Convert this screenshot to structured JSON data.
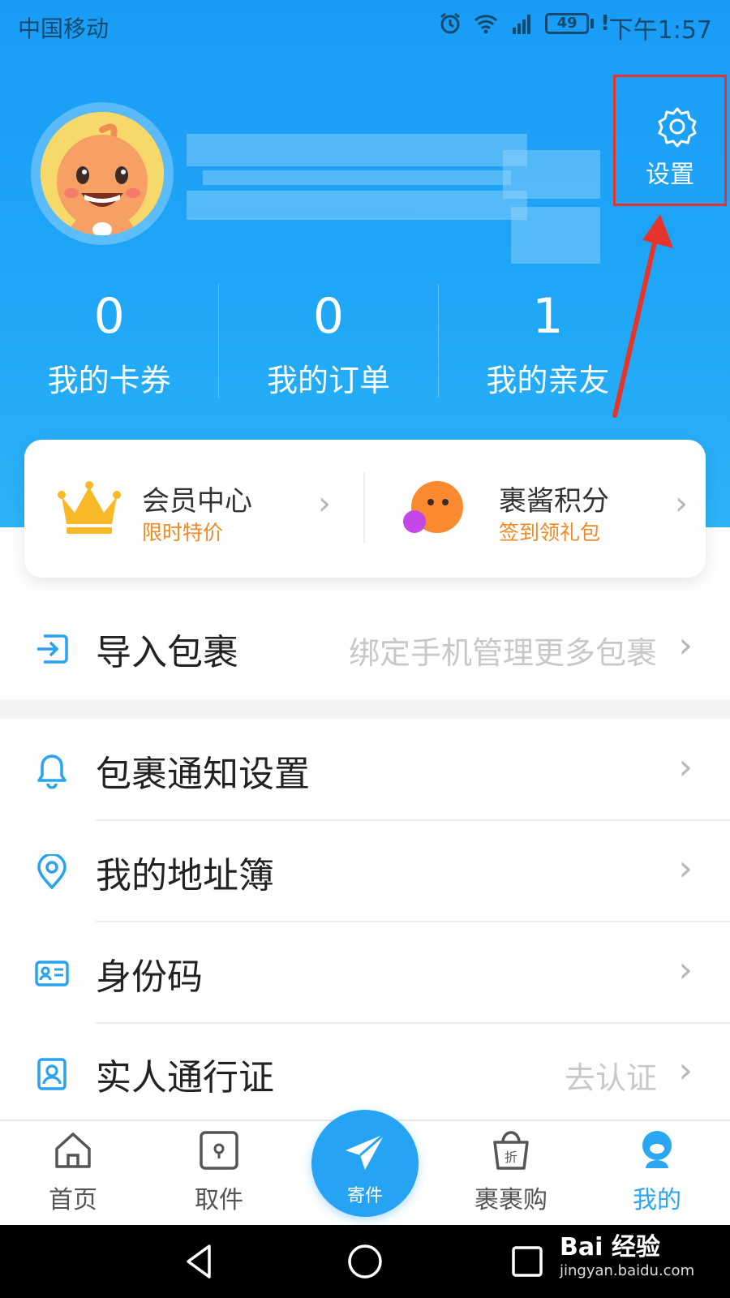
{
  "status_bar": {
    "carrier": "中国移动",
    "battery": "49",
    "time": "下午1:57"
  },
  "header": {
    "settings_label": "设置",
    "stats": [
      {
        "value": "0",
        "label": "我的卡券"
      },
      {
        "value": "0",
        "label": "我的订单"
      },
      {
        "value": "1",
        "label": "我的亲友"
      }
    ]
  },
  "member_card": {
    "left": {
      "title": "会员中心",
      "subtitle": "限时特价"
    },
    "right": {
      "title": "裹酱积分",
      "subtitle": "签到领礼包"
    }
  },
  "list": [
    {
      "label": "导入包裹",
      "hint": "绑定手机管理更多包裹",
      "icon": "import-icon"
    },
    {
      "label": "包裹通知设置",
      "hint": "",
      "icon": "bell-icon"
    },
    {
      "label": "我的地址簿",
      "hint": "",
      "icon": "location-pin-icon"
    },
    {
      "label": "身份码",
      "hint": "",
      "icon": "id-card-icon"
    },
    {
      "label": "实人通行证",
      "hint": "去认证",
      "icon": "person-badge-icon"
    }
  ],
  "tabbar": {
    "tabs": [
      {
        "label": "首页",
        "icon": "home-icon"
      },
      {
        "label": "取件",
        "icon": "locker-icon"
      },
      {
        "label": "裹裹购",
        "icon": "shopping-bag-icon"
      },
      {
        "label": "我的",
        "icon": "profile-icon",
        "active": true
      }
    ],
    "center": {
      "label": "寄件",
      "icon": "paper-plane-icon"
    }
  },
  "watermark": {
    "brand": "Bai 经验",
    "url": "jingyan.baidu.com"
  },
  "colors": {
    "primary": "#20a7f6",
    "accent_orange": "#f08a24",
    "highlight_red": "#e6342b"
  }
}
